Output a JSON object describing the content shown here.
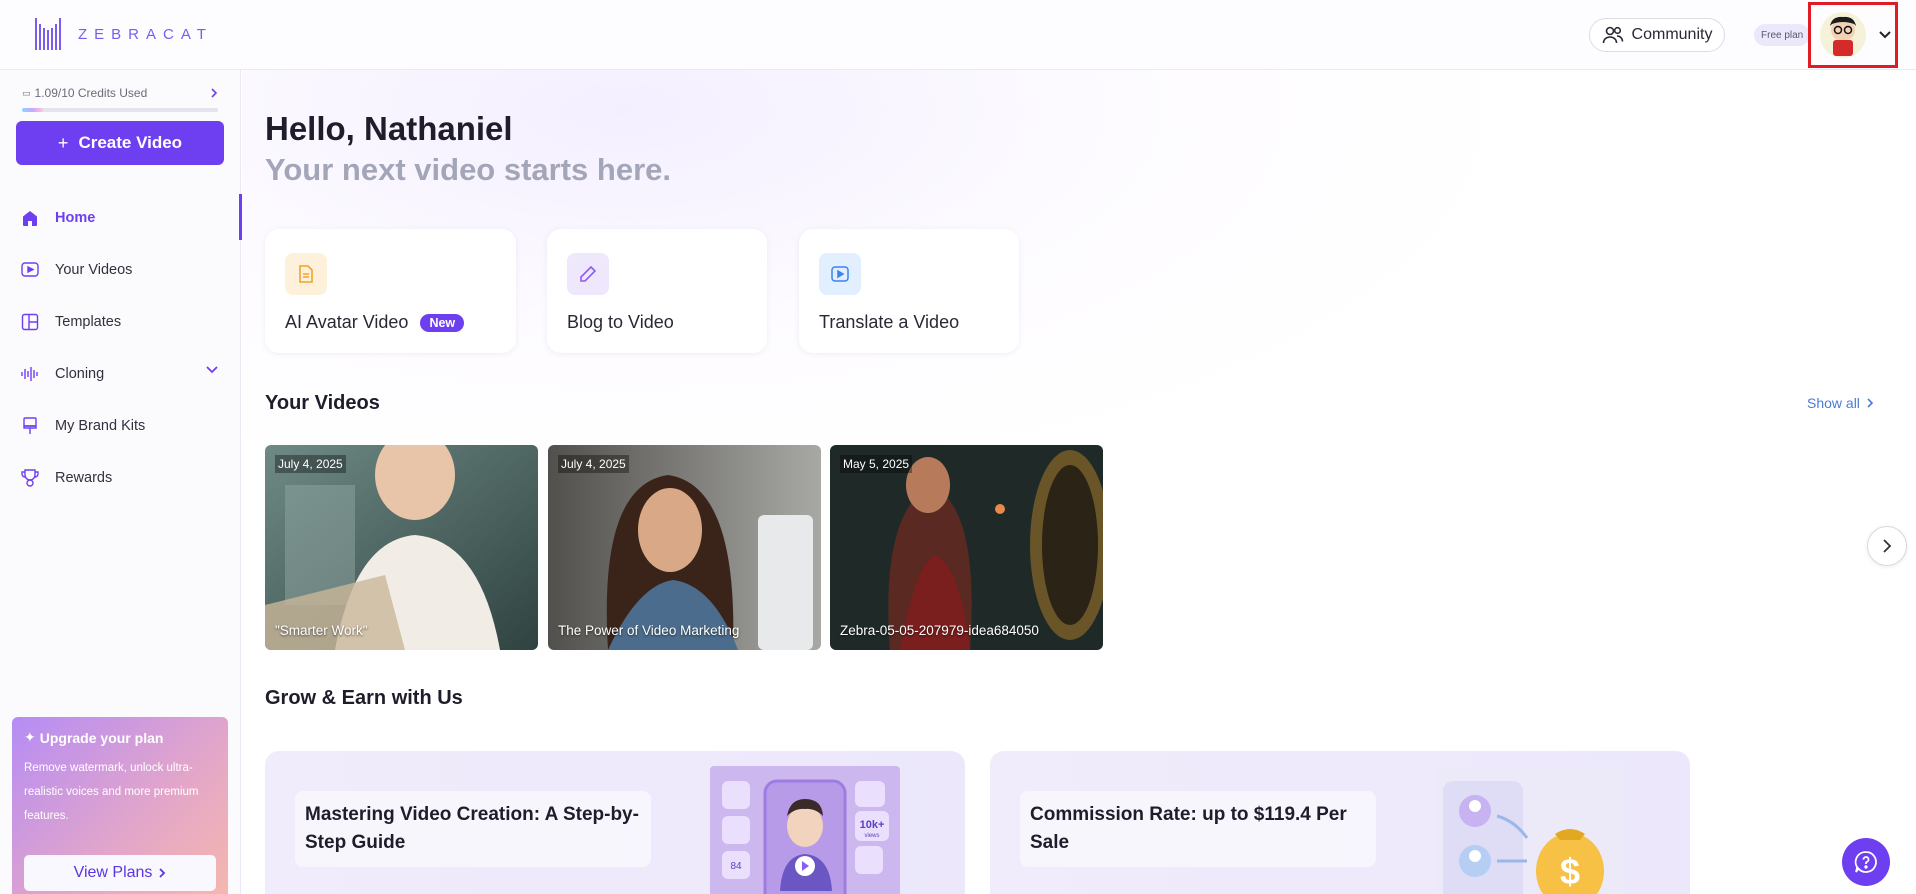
{
  "brand": {
    "name": "ZEBRACAT"
  },
  "header": {
    "community_label": "Community",
    "plan_badge": "Free plan"
  },
  "sidebar": {
    "credits": "1.09/10 Credits Used",
    "credits_fraction": 0.109,
    "create_label": "Create Video",
    "items": [
      {
        "label": "Home",
        "icon": "home-icon",
        "active": true
      },
      {
        "label": "Your Videos",
        "icon": "video-icon"
      },
      {
        "label": "Templates",
        "icon": "templates-icon"
      },
      {
        "label": "Cloning",
        "icon": "waveform-icon"
      },
      {
        "label": "My Brand Kits",
        "icon": "brush-icon"
      },
      {
        "label": "Rewards",
        "icon": "trophy-icon"
      }
    ],
    "upgrade": {
      "title": "Upgrade your plan",
      "description": "Remove watermark, unlock ultra-realistic voices and more premium features.",
      "button_label": "View Plans"
    }
  },
  "main": {
    "greeting": "Hello, Nathaniel",
    "tagline": "Your next video starts here.",
    "quick_actions": [
      {
        "label": "AI Avatar Video",
        "badge": "New",
        "icon": "document-icon",
        "color": "#f4a32a"
      },
      {
        "label": "Blog to Video",
        "icon": "pencil-icon",
        "color": "#8b5cf6"
      },
      {
        "label": "Translate a Video",
        "icon": "play-icon",
        "color": "#3b82f6"
      }
    ],
    "your_videos": {
      "title": "Your Videos",
      "show_all": "Show all",
      "items": [
        {
          "date": "July 4, 2025",
          "title": "\"Smarter Work\""
        },
        {
          "date": "July 4, 2025",
          "title": "The Power of Video Marketing"
        },
        {
          "date": "May 5, 2025",
          "title": "Zebra-05-05-207979-idea684050"
        }
      ]
    },
    "grow": {
      "title": "Grow & Earn with Us",
      "cards": [
        {
          "title": "Mastering Video Creation: A Step-by-Step Guide",
          "art_stats": [
            "10k+",
            "views",
            "84"
          ]
        },
        {
          "title": "Commission Rate: up to $119.4 Per Sale",
          "art_symbol": "$"
        }
      ]
    }
  },
  "colors": {
    "accent": "#6e3ff0",
    "link": "#4a7cd6"
  }
}
